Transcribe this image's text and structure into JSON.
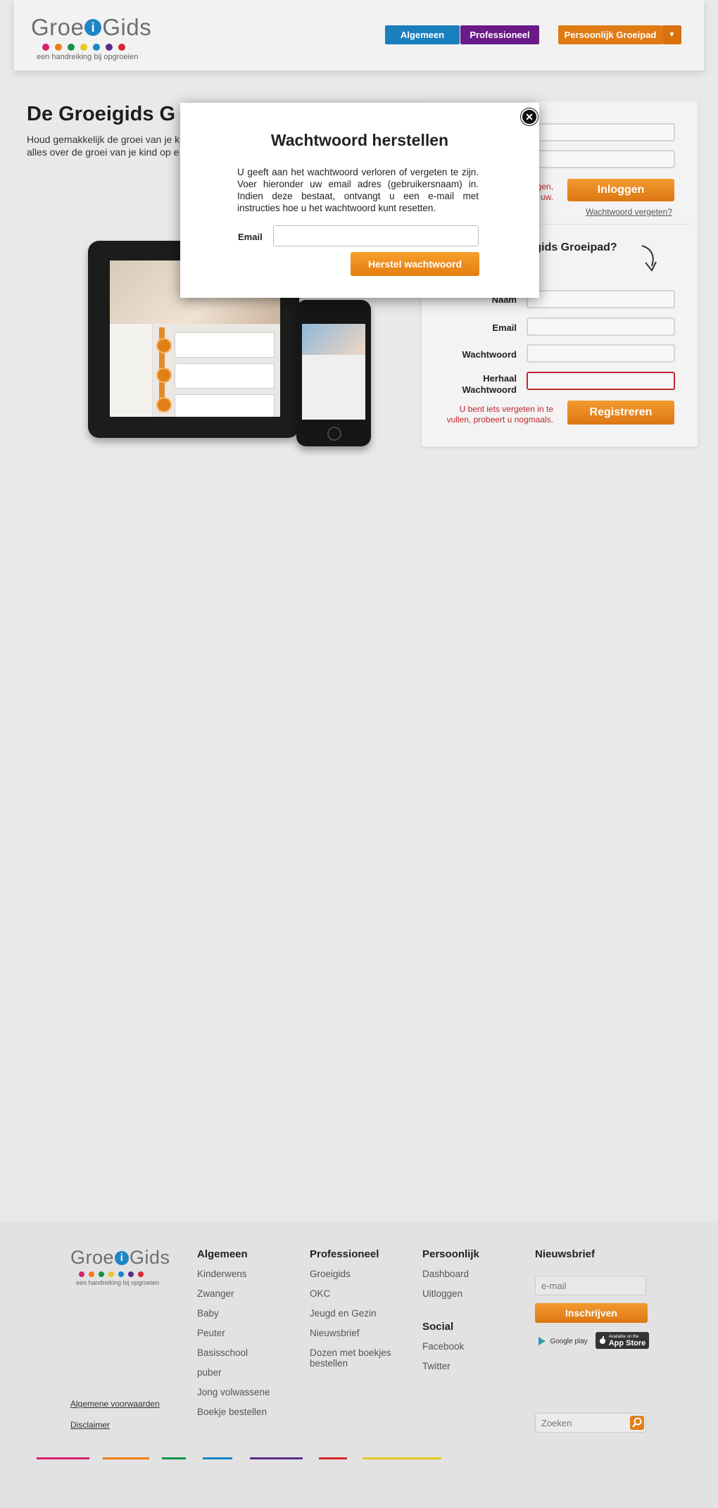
{
  "header": {
    "logo": {
      "name": "Groe",
      "i": "i",
      "name2": "Gids",
      "tagline": "een handreiking bij opgroeien"
    },
    "nav": {
      "algemeen": "Algemeen",
      "professioneel": "Professioneel",
      "persoonlijk": "Persoonlijk Groeipad",
      "dropdown": "▼"
    }
  },
  "hero": {
    "title": "De Groeigids G",
    "text_line1": "Houd gemakkelijk de groei van je k",
    "text_line2": "alles over de groei van je kind op e"
  },
  "login": {
    "error_line1": "gen,",
    "error_line2": "uw.",
    "button": "Inloggen",
    "forgot": "Wachtwoord vergeten?"
  },
  "register": {
    "heading_line1": "eigids Groeipad?",
    "heading_line2": "u!",
    "labels": {
      "naam": "Naam",
      "email": "Email",
      "wachtwoord": "Wachtwoord",
      "herhaal1": "Herhaal",
      "herhaal2": "Wachtwoord"
    },
    "error_line1": "U bent iets vergeten in te",
    "error_line2": "vullen, probeert u nogmaals.",
    "button": "Registreren"
  },
  "modal": {
    "title": "Wachtwoord herstellen",
    "text": "U geeft aan het wachtwoord verloren of vergeten te zijn. Voer hieronder uw email adres (gebruikersnaam) in. Indien deze bestaat, ontvangt u een e-mail met instructies hoe u het wachtwoord kunt resetten.",
    "email_label": "Email",
    "email_value": "",
    "button": "Herstel wachtwoord",
    "close": "✕"
  },
  "footer": {
    "algemeen": {
      "title": "Algemeen",
      "links": [
        "Kinderwens",
        "Zwanger",
        "Baby",
        "Peuter",
        "Basisschool",
        "puber",
        "Jong volwassene",
        "Boekje bestellen"
      ]
    },
    "professioneel": {
      "title": "Professioneel",
      "links": [
        "Groeigids",
        "OKC",
        "Jeugd en Gezin",
        "Nieuwsbrief",
        "Dozen met boekjes bestellen"
      ]
    },
    "persoonlijk": {
      "title": "Persoonlijk",
      "links": [
        "Dashboard",
        "Uitloggen"
      ]
    },
    "social": {
      "title": "Social",
      "links": [
        "Facebook",
        "Twitter"
      ]
    },
    "nieuwsbrief": {
      "title": "Nieuwsbrief",
      "placeholder": "e-mail",
      "button": "Inschrijven"
    },
    "badges": {
      "google": "Google play",
      "apple_small": "Available on the",
      "apple": "App Store"
    },
    "legal": {
      "voorwaarden": "Algemene voorwaarden",
      "disclaimer": "Disclaimer"
    },
    "search_placeholder": "Zoeken"
  },
  "colors": {
    "brand_orange": "#e07b14",
    "brand_blue": "#1a7fbd",
    "brand_purple": "#6a1b87",
    "error_red": "#c0272d",
    "logo_dots": [
      "#d6206f",
      "#ef7d12",
      "#15934a",
      "#e7c81c",
      "#1a86c7",
      "#5a2d87",
      "#d9262f"
    ]
  },
  "icons": [
    "close-icon",
    "arrow-down-icon",
    "search-icon",
    "dropdown-icon",
    "google-play-icon",
    "apple-icon"
  ]
}
